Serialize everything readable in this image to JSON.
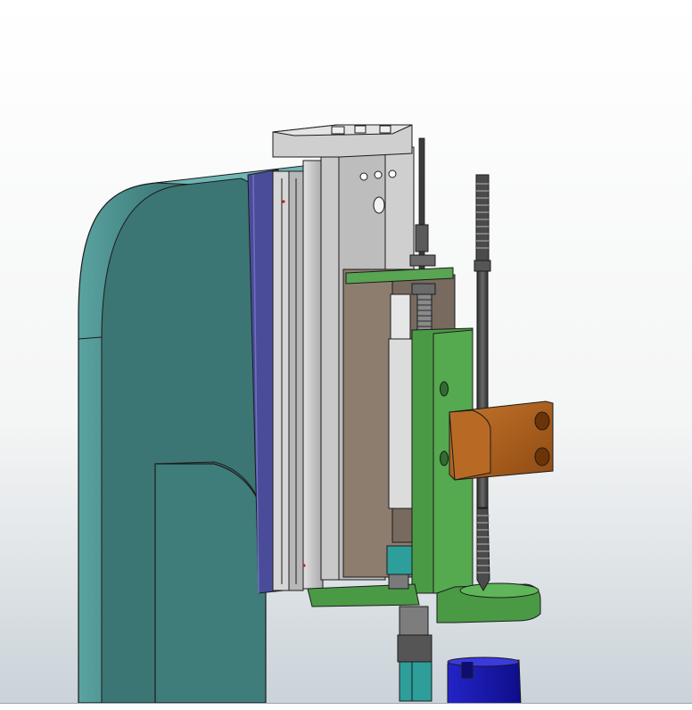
{
  "viewport": {
    "background_top": "#ffffff",
    "background_bottom": "#c9d2d8"
  },
  "colors": {
    "frame_teal": "#3d7a78",
    "frame_teal_light": "#5aa3a1",
    "plate_blue": "#4a4c9a",
    "rail_gray": "#c8c8c8",
    "rail_gray_dark": "#a9a9a9",
    "cylinder_brown": "#8d7d6f",
    "bracket_green": "#4a9a45",
    "block_orange": "#b0601c",
    "spindle_dark": "#474747",
    "collet_cyan": "#2e9e9a",
    "cup_blue": "#1a1ab0",
    "outline": "#1c1c1c"
  },
  "parts": [
    "c-frame",
    "back-plate",
    "slide-rail",
    "cylinder-body",
    "top-cap",
    "sensor-rod",
    "green-bracket",
    "guide-block",
    "threaded-spindle",
    "base-flange",
    "lower-collet",
    "blue-cup"
  ]
}
